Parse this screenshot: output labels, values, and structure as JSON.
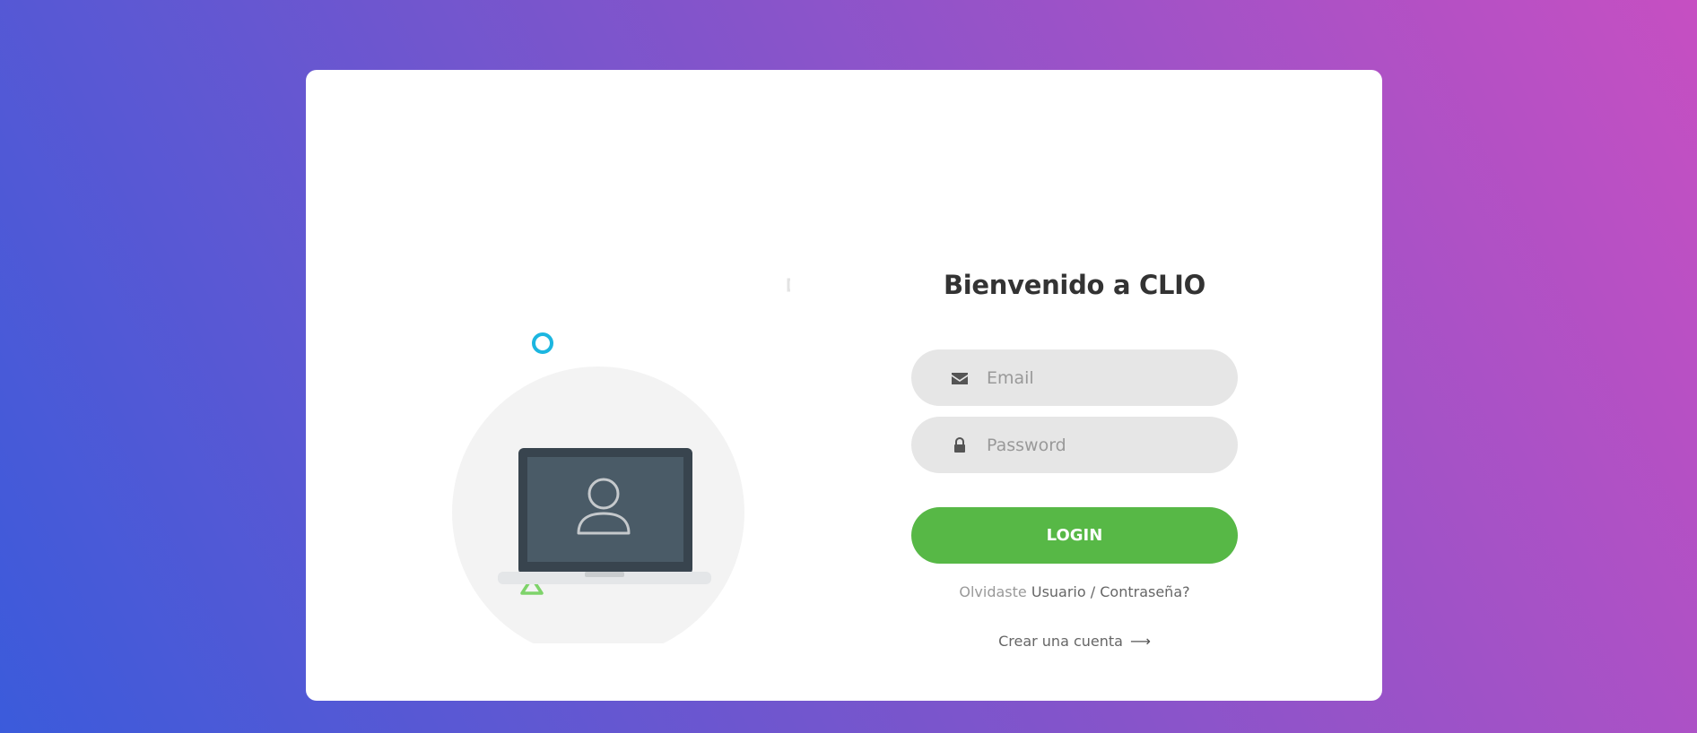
{
  "login": {
    "title": "Bienvenido a CLIO",
    "email_placeholder": "Email",
    "password_placeholder": "Password",
    "button_label": "LOGIN",
    "forgot_prefix": "Olvidaste",
    "forgot_user": "Usuario",
    "forgot_separator": " / ",
    "forgot_password": "Contraseña?",
    "create_account": "Crear una cuenta",
    "create_arrow": "⟶"
  },
  "icons": {
    "email": "envelope-icon",
    "password": "lock-icon",
    "illustration": "laptop-user-icon"
  },
  "colors": {
    "gradient_start": "#3b5bdb",
    "gradient_end": "#c64fc2",
    "button": "#57b846",
    "accent_cyan": "#1cb6e0",
    "accent_green": "#7ed36a"
  }
}
